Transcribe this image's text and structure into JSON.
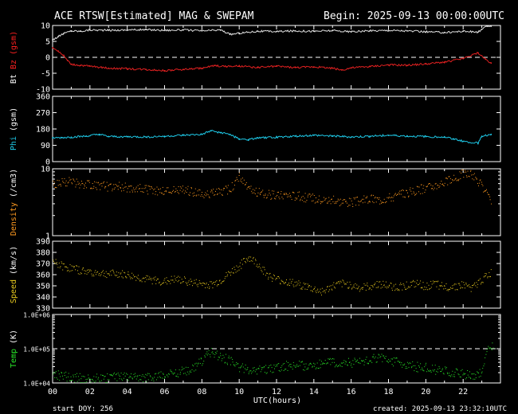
{
  "header": {
    "title": "ACE RTSW[Estimated] MAG & SWEPAM",
    "begin": "Begin: 2025-09-13 00:00:00UTC"
  },
  "footer": {
    "start_doy": "start DOY: 256",
    "created": "created: 2025-09-13 23:32:10UTC"
  },
  "chart_data": [
    {
      "type": "line",
      "panel": "mag",
      "ylabel_parts": [
        {
          "text": "Bt",
          "color": "#ffffff"
        },
        {
          "text": " ",
          "color": "#ffffff"
        },
        {
          "text": "Bz",
          "color": "#ff2020"
        },
        {
          "text": " (gsm)",
          "color": "#ff2020"
        }
      ],
      "ylim": [
        -10,
        10
      ],
      "ytick_values": [
        10,
        5,
        0,
        -5,
        -10
      ],
      "ytick_labels": [
        "10",
        "5",
        "0",
        "-5",
        "-10"
      ],
      "dashed_reference": 0,
      "series": [
        {
          "name": "Bt",
          "color": "#e0e0e0",
          "x": [
            0.0,
            0.3,
            0.6,
            1.0,
            1.5,
            2.0,
            3.0,
            4.0,
            5.0,
            6.0,
            7.0,
            8.0,
            9.0,
            9.5,
            10.0,
            11.0,
            12.0,
            13.0,
            14.0,
            15.0,
            16.0,
            17.0,
            18.0,
            19.0,
            20.0,
            21.0,
            22.0,
            22.8,
            23.0,
            23.3,
            23.5
          ],
          "values": [
            5.5,
            6.5,
            7.5,
            8.3,
            8.2,
            8.6,
            8.5,
            8.6,
            8.7,
            8.5,
            8.6,
            8.3,
            8.6,
            7.2,
            7.6,
            8.2,
            8.1,
            8.3,
            8.2,
            8.4,
            8.0,
            8.3,
            8.5,
            8.3,
            8.0,
            7.8,
            8.2,
            7.9,
            8.8,
            9.8,
            10.0
          ]
        },
        {
          "name": "Bz",
          "color": "#e02020",
          "x": [
            0.0,
            0.3,
            0.6,
            0.8,
            1.0,
            1.5,
            2.0,
            3.0,
            4.0,
            5.0,
            6.0,
            7.0,
            8.0,
            8.7,
            9.3,
            10.0,
            11.0,
            12.0,
            13.0,
            14.0,
            15.0,
            15.5,
            16.0,
            17.0,
            18.0,
            19.0,
            20.0,
            21.0,
            22.0,
            22.8,
            23.2,
            23.5
          ],
          "values": [
            3.0,
            2.0,
            0.5,
            -1.0,
            -2.2,
            -2.5,
            -2.8,
            -3.4,
            -3.6,
            -3.8,
            -4.2,
            -3.8,
            -3.4,
            -2.6,
            -2.9,
            -2.8,
            -3.2,
            -2.8,
            -3.2,
            -3.0,
            -3.4,
            -4.0,
            -3.3,
            -2.9,
            -2.4,
            -2.5,
            -2.1,
            -1.5,
            -0.4,
            1.4,
            -0.6,
            -1.8
          ]
        }
      ]
    },
    {
      "type": "line",
      "panel": "phi",
      "ylabel_parts": [
        {
          "text": "Phi",
          "color": "#1ec8e6"
        },
        {
          "text": " (gsm)",
          "color": "#ffffff"
        }
      ],
      "ylim": [
        0,
        360
      ],
      "ytick_values": [
        360,
        270,
        180,
        90,
        0
      ],
      "ytick_labels": [
        "360",
        "270",
        "180",
        "90",
        "0"
      ],
      "series": [
        {
          "name": "Phi",
          "color": "#1ec8e6",
          "x": [
            0.0,
            0.5,
            1.0,
            1.8,
            2.5,
            3.0,
            4.0,
            5.0,
            6.0,
            7.0,
            8.0,
            8.5,
            9.0,
            9.5,
            10.0,
            10.5,
            11.0,
            12.0,
            13.0,
            14.0,
            15.0,
            16.0,
            17.0,
            18.0,
            19.0,
            20.0,
            21.0,
            21.5,
            22.0,
            22.8,
            23.0,
            23.5
          ],
          "values": [
            130,
            132,
            135,
            140,
            150,
            138,
            137,
            136,
            140,
            145,
            150,
            170,
            160,
            150,
            125,
            120,
            130,
            135,
            140,
            145,
            142,
            135,
            140,
            145,
            140,
            138,
            135,
            125,
            112,
            102,
            140,
            150
          ]
        }
      ]
    },
    {
      "type": "scatter",
      "panel": "density",
      "ylabel_parts": [
        {
          "text": "Density",
          "color": "#ff9a20"
        },
        {
          "text": " (/cm3)",
          "color": "#ffffff"
        }
      ],
      "ylim": [
        1,
        10
      ],
      "yscale": "log",
      "ytick_values": [
        10,
        1
      ],
      "ytick_labels": [
        "10",
        "1"
      ],
      "series": [
        {
          "name": "Density",
          "color": "#ff9a20",
          "x": [
            0.0,
            0.5,
            1.0,
            1.5,
            2.0,
            2.5,
            3.0,
            3.5,
            4.0,
            4.5,
            5.0,
            5.5,
            6.0,
            6.5,
            7.0,
            7.5,
            8.0,
            8.5,
            9.0,
            9.5,
            10.0,
            10.5,
            11.0,
            11.5,
            12.0,
            12.5,
            13.0,
            13.5,
            14.0,
            14.5,
            15.0,
            15.5,
            16.0,
            16.5,
            17.0,
            17.5,
            18.0,
            18.5,
            19.0,
            19.5,
            20.0,
            20.5,
            21.0,
            21.5,
            22.0,
            22.5,
            23.0,
            23.5
          ],
          "values": [
            6.0,
            6.5,
            6.4,
            6.0,
            5.8,
            5.6,
            5.4,
            5.5,
            5.3,
            5.1,
            5.0,
            4.7,
            4.6,
            4.8,
            4.9,
            4.5,
            4.4,
            4.3,
            4.6,
            5.0,
            7.5,
            4.8,
            4.5,
            4.2,
            4.0,
            4.2,
            4.0,
            3.8,
            3.6,
            3.5,
            3.4,
            3.3,
            3.2,
            3.4,
            3.6,
            3.5,
            3.8,
            4.0,
            4.5,
            4.8,
            5.2,
            5.8,
            6.5,
            7.0,
            8.8,
            8.2,
            5.5,
            3.0
          ]
        }
      ]
    },
    {
      "type": "scatter",
      "panel": "speed",
      "ylabel_parts": [
        {
          "text": "Speed",
          "color": "#e6c81e"
        },
        {
          "text": " (km/s)",
          "color": "#ffffff"
        }
      ],
      "ylim": [
        330,
        390
      ],
      "ytick_values": [
        390,
        380,
        370,
        360,
        350,
        340,
        330
      ],
      "ytick_labels": [
        "390",
        "380",
        "370",
        "360",
        "350",
        "340",
        "330"
      ],
      "series": [
        {
          "name": "Speed",
          "color": "#e6c81e",
          "x": [
            0.0,
            0.5,
            1.0,
            1.5,
            2.0,
            2.5,
            3.0,
            3.5,
            4.0,
            4.5,
            5.0,
            5.5,
            6.0,
            6.5,
            7.0,
            7.5,
            8.0,
            8.5,
            9.0,
            9.5,
            10.0,
            10.5,
            11.0,
            11.5,
            12.0,
            12.5,
            13.0,
            13.5,
            14.0,
            14.5,
            15.0,
            15.5,
            16.0,
            16.5,
            17.0,
            17.5,
            18.0,
            18.5,
            19.0,
            19.5,
            20.0,
            20.5,
            21.0,
            21.5,
            22.0,
            22.5,
            23.0,
            23.5
          ],
          "values": [
            372,
            368,
            366,
            364,
            363,
            362,
            361,
            361,
            360,
            358,
            356,
            355,
            354,
            356,
            355,
            353,
            352,
            351,
            355,
            362,
            368,
            376,
            370,
            360,
            356,
            354,
            352,
            350,
            347,
            345,
            350,
            352,
            351,
            348,
            350,
            352,
            350,
            349,
            351,
            352,
            350,
            352,
            349,
            350,
            351,
            348,
            356,
            362
          ]
        }
      ]
    },
    {
      "type": "scatter",
      "panel": "temp",
      "ylabel_parts": [
        {
          "text": "Temp",
          "color": "#28e628"
        },
        {
          "text": " (K)",
          "color": "#ffffff"
        }
      ],
      "ylim": [
        10000,
        1000000
      ],
      "yscale": "log",
      "ytick_values": [
        1000000,
        100000,
        10000
      ],
      "ytick_labels": [
        "1.0E+06",
        "1.0E+05",
        "1.0E+04"
      ],
      "dashed_reference": 100000,
      "series": [
        {
          "name": "Temp",
          "color": "#28e628",
          "x": [
            0.0,
            0.5,
            1.0,
            1.5,
            2.0,
            2.5,
            3.0,
            3.5,
            4.0,
            4.5,
            5.0,
            5.5,
            6.0,
            6.5,
            7.0,
            7.5,
            8.0,
            8.5,
            9.0,
            9.5,
            10.0,
            10.5,
            11.0,
            11.5,
            12.0,
            12.5,
            13.0,
            13.5,
            14.0,
            14.5,
            15.0,
            15.5,
            16.0,
            16.5,
            17.0,
            17.5,
            18.0,
            18.5,
            19.0,
            19.5,
            20.0,
            20.5,
            21.0,
            21.5,
            22.0,
            22.5,
            23.0,
            23.3,
            23.6
          ],
          "values": [
            18000,
            16000,
            15000,
            14000,
            14500,
            14000,
            14000,
            15000,
            15000,
            14500,
            15000,
            16000,
            18000,
            20000,
            22000,
            26000,
            45000,
            80000,
            60000,
            45000,
            30000,
            25000,
            24000,
            26000,
            28000,
            32000,
            34000,
            32000,
            34000,
            36000,
            40000,
            42000,
            40000,
            45000,
            50000,
            55000,
            48000,
            40000,
            35000,
            30000,
            28000,
            25000,
            22000,
            20000,
            18000,
            17000,
            20000,
            90000,
            120000
          ]
        }
      ]
    }
  ],
  "x_axis": {
    "xlim": [
      0,
      24
    ],
    "tick_values": [
      0,
      2,
      4,
      6,
      8,
      10,
      12,
      14,
      16,
      18,
      20,
      22
    ],
    "tick_labels": [
      "00",
      "02",
      "04",
      "06",
      "08",
      "10",
      "12",
      "14",
      "16",
      "18",
      "20",
      "22"
    ],
    "label": "UTC(hours)"
  },
  "colors": {
    "background": "#000000",
    "frame": "#ffffff",
    "dash": "#ffffff"
  }
}
